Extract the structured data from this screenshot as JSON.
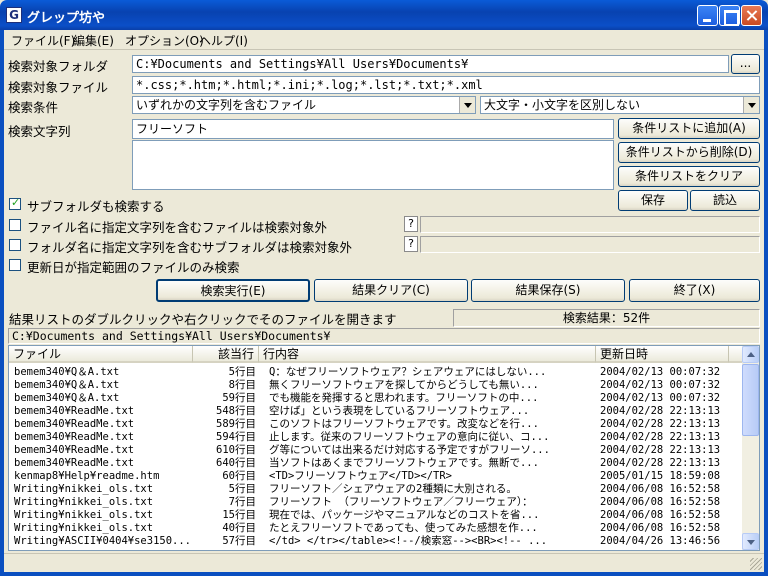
{
  "window": {
    "title": "グレップ坊や",
    "icon_letter": "G"
  },
  "menu": [
    "ファイル(F)",
    "編集(E)",
    "オプション(O)",
    "ヘルプ(I)"
  ],
  "form": {
    "folder_label": "検索対象フォルダ",
    "folder_value": "C:¥Documents and Settings¥All Users¥Documents¥",
    "browse_label": "...",
    "files_label": "検索対象ファイル",
    "files_value": "*.css;*.htm;*.html;*.ini;*.log;*.lst;*.txt;*.xml",
    "condition_label": "検索条件",
    "condition_value": "いずれかの文字列を含むファイル",
    "case_value": "大文字・小文字を区別しない",
    "search_label": "検索文字列",
    "search_value": "フリーソフト",
    "btn_add": "条件リストに追加(A)",
    "btn_remove": "条件リストから削除(D)",
    "btn_clear": "条件リストをクリア",
    "btn_save": "保存",
    "btn_load": "読込",
    "opt_subfolder": "サブフォルダも検索する",
    "opt_exclude_file": "ファイル名に指定文字列を含むファイルは検索対象外",
    "opt_exclude_folder": "フォルダ名に指定文字列を含むサブフォルダは検索対象外",
    "opt_date": "更新日が指定範囲のファイルのみ検索",
    "q_mark": "?"
  },
  "actions": {
    "run": "検索実行(E)",
    "clear": "結果クリア(C)",
    "save": "結果保存(S)",
    "exit": "終了(X)"
  },
  "results": {
    "hint": "結果リストのダブルクリックや右クリックでそのファイルを開きます",
    "count": "検索結果：52件",
    "path": "C:¥Documents and Settings¥All Users¥Documents¥",
    "columns": [
      "ファイル",
      "該当行",
      "行内容",
      "更新日時"
    ],
    "rows": [
      [
        "bemem340¥Q＆A.txt",
        "5行目",
        "Q：なぜフリーソフトウェア？シェアウェアにはしない...",
        "2004/02/13 00:07:32"
      ],
      [
        "bemem340¥Q＆A.txt",
        "8行目",
        "無くフリーソフトウェアを探してからどうしても無い...",
        "2004/02/13 00:07:32"
      ],
      [
        "bemem340¥Q＆A.txt",
        "59行目",
        "でも機能を発揮すると思われます。フリーソフトの中...",
        "2004/02/13 00:07:32"
      ],
      [
        "bemem340¥ReadMe.txt",
        "548行目",
        "空けば」という表現をしているフリーソフトウェア...",
        "2004/02/28 22:13:13"
      ],
      [
        "bemem340¥ReadMe.txt",
        "589行目",
        "このソフトはフリーソフトウェアです。改変などを行...",
        "2004/02/28 22:13:13"
      ],
      [
        "bemem340¥ReadMe.txt",
        "594行目",
        "止します。従来のフリーソフトウェアの意向に従い、コ...",
        "2004/02/28 22:13:13"
      ],
      [
        "bemem340¥ReadMe.txt",
        "610行目",
        "グ等については出来るだけ対応する予定ですがフリーソ...",
        "2004/02/28 22:13:13"
      ],
      [
        "bemem340¥ReadMe.txt",
        "640行目",
        "当ソフトはあくまでフリーソフトウェアです。無断で...",
        "2004/02/28 22:13:13"
      ],
      [
        "kenmap8¥Help¥readme.htm",
        "60行目",
        "<TD>フリーソフトウェア</TD></TR>",
        "2005/01/15 18:59:08"
      ],
      [
        "Writing¥nikkei_ols.txt",
        "5行目",
        "フリーソフト／シェアウェアの2種類に大別される。",
        "2004/06/08 16:52:58"
      ],
      [
        "Writing¥nikkei_ols.txt",
        "7行目",
        "フリーソフト （フリーソフトウェア／フリーウェア）：",
        "2004/06/08 16:52:58"
      ],
      [
        "Writing¥nikkei_ols.txt",
        "15行目",
        "現在では、パッケージやマニュアルなどのコストを省...",
        "2004/06/08 16:52:58"
      ],
      [
        "Writing¥nikkei_ols.txt",
        "40行目",
        "たとえフリーソフトであっても、使ってみた感想を作...",
        "2004/06/08 16:52:58"
      ],
      [
        "Writing¥ASCII¥0404¥se3150...",
        "57行目",
        "</td>  </tr></table><!--/検索窓--><BR><!-- ...",
        "2004/04/26 13:46:56"
      ]
    ]
  }
}
